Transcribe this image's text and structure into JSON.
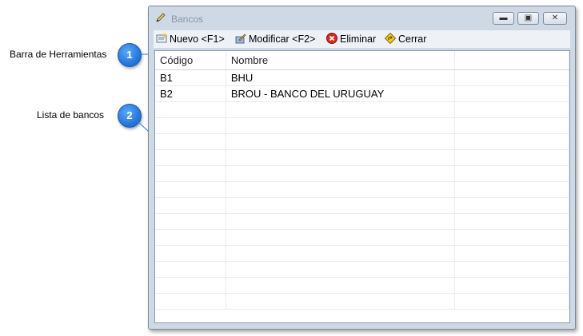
{
  "callouts": [
    {
      "number": "1",
      "label": "Barra de Herramientas"
    },
    {
      "number": "2",
      "label": "Lista de bancos"
    }
  ],
  "window": {
    "title": "Bancos",
    "controls": {
      "minimize": "minimize-icon",
      "maximize": "maximize-icon",
      "close": "close-icon"
    }
  },
  "toolbar": {
    "nuevo": "Nuevo <F1>",
    "modificar": "Modificar <F2>",
    "eliminar": "Eliminar",
    "cerrar": "Cerrar"
  },
  "table": {
    "columns": [
      "Código",
      "Nombre",
      ""
    ],
    "rows": [
      {
        "codigo": "B1",
        "nombre": "BHU"
      },
      {
        "codigo": "B2",
        "nombre": "BROU - BANCO DEL URUGUAY"
      }
    ]
  },
  "colors": {
    "accent": "#2a7de1",
    "window_frame": "#cfd9e6"
  }
}
